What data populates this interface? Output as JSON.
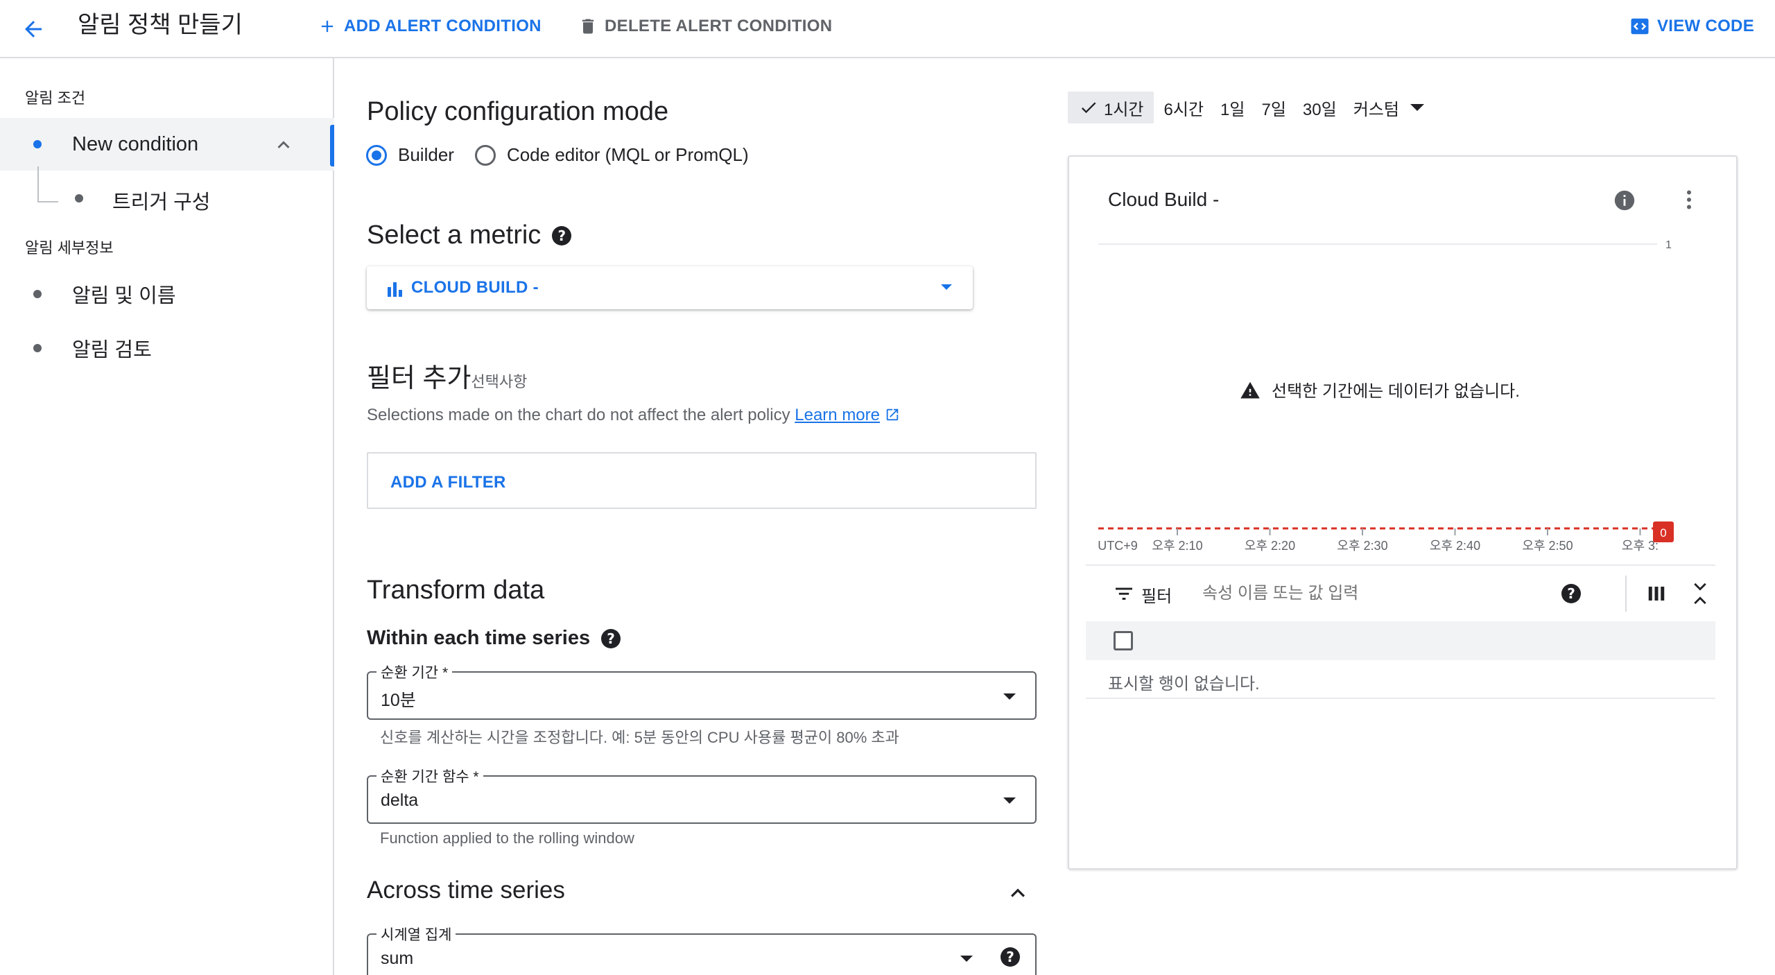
{
  "header": {
    "title": "알림 정책 만들기",
    "add_condition": "ADD ALERT CONDITION",
    "delete_condition": "DELETE ALERT CONDITION",
    "view_code": "VIEW CODE"
  },
  "sidebar": {
    "section_conditions": "알림 조건",
    "condition_item": "New condition",
    "trigger_item": "트리거 구성",
    "section_details": "알림 세부정보",
    "notify_item": "알림 및 이름",
    "review_item": "알림 검토"
  },
  "main": {
    "mode_title": "Policy configuration mode",
    "mode_builder": "Builder",
    "mode_code": "Code editor (MQL or PromQL)",
    "metric_title": "Select a metric",
    "metric_value": "CLOUD BUILD -",
    "filter_title": "필터 추가",
    "filter_optional": "선택사항",
    "filter_desc": "Selections made on the chart do not affect the alert policy",
    "learn_more": "Learn more",
    "add_filter": "ADD A FILTER",
    "transform_title": "Transform data",
    "within_title": "Within each time series",
    "rolling_window_label": "순환 기간 *",
    "rolling_window_value": "10분",
    "rolling_window_hint": "신호를 계산하는 시간을 조정합니다. 예: 5분 동안의 CPU 사용률 평균이 80% 초과",
    "rolling_fn_label": "순환 기간 함수 *",
    "rolling_fn_value": "delta",
    "rolling_fn_hint": "Function applied to the rolling window",
    "across_title": "Across time series",
    "aggregation_label": "시계열 집계",
    "aggregation_value": "sum"
  },
  "time_range": {
    "options": [
      "1시간",
      "6시간",
      "1일",
      "7일",
      "30일",
      "커스텀"
    ],
    "selected": "1시간"
  },
  "chart_panel": {
    "title": "Cloud Build -",
    "no_data": "선택한 기간에는 데이터가 없습니다.",
    "filter_label": "필터",
    "filter_placeholder": "속성 이름 또는 값 입력",
    "empty_rows": "표시할 행이 없습니다."
  },
  "chart_data": {
    "type": "line",
    "title": "Cloud Build -",
    "x_ticks": [
      "UTC+9",
      "오후 2:10",
      "오후 2:20",
      "오후 2:30",
      "오후 2:40",
      "오후 2:50",
      "오후 3:"
    ],
    "y_ticks": [
      "1",
      "0"
    ],
    "ylim": [
      0,
      1
    ],
    "series": [],
    "threshold": {
      "value": 0,
      "label": "0",
      "color": "#d93025"
    }
  },
  "colors": {
    "accent": "#1a73e8",
    "threshold": "#d93025",
    "text": "#202124",
    "muted": "#5f6368"
  }
}
